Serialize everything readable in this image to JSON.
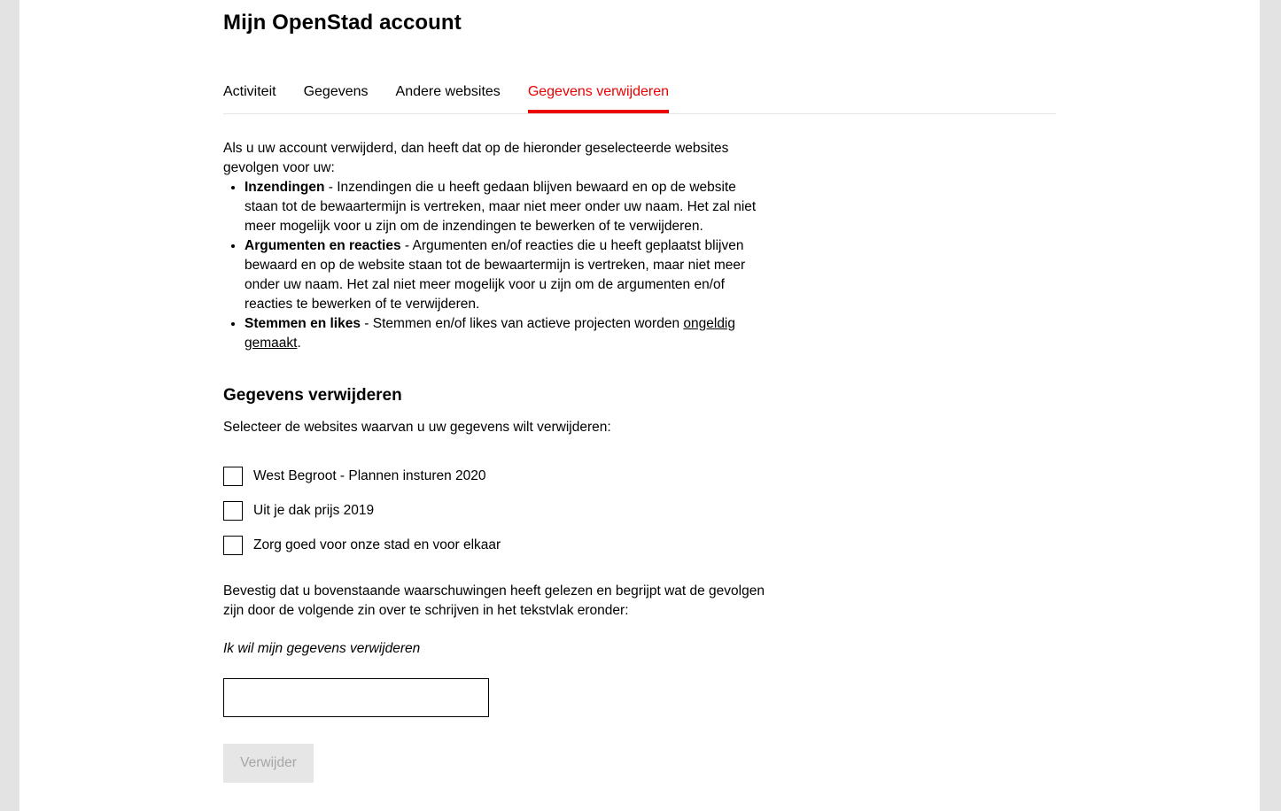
{
  "header": {
    "title": "Mijn OpenStad account"
  },
  "tabs": [
    {
      "label": "Activiteit"
    },
    {
      "label": "Gegevens"
    },
    {
      "label": "Andere websites"
    },
    {
      "label": "Gegevens verwijderen",
      "active": true
    }
  ],
  "intro": {
    "text": "Als u uw account verwijderd, dan heeft dat op de hieronder geselecteerde websites gevolgen voor uw:",
    "items": [
      {
        "title": "Inzendingen",
        "text": " - Inzendingen die u heeft gedaan blijven bewaard en op de website staan tot de bewaartermijn is vertreken, maar niet meer onder uw naam. Het zal niet meer mogelijk voor u zijn om de inzendingen te bewerken of te verwijderen."
      },
      {
        "title": "Argumenten en reacties",
        "text": " - Argumenten en/of reacties die u heeft geplaatst blijven bewaard en op de website staan tot de bewaartermijn is vertreken, maar niet meer onder uw naam. Het zal niet meer mogelijk voor u zijn om de argumenten en/of reacties te bewerken of te verwijderen."
      },
      {
        "title": "Stemmen en likes",
        "text": " - Stemmen en/of likes van actieve projecten worden ",
        "link": "ongeldig gemaakt",
        "after": "."
      }
    ]
  },
  "section": {
    "title": "Gegevens verwijderen",
    "select_text": "Selecteer de websites waarvan u uw gegevens wilt verwijderen:",
    "sites": [
      {
        "label": "West Begroot - Plannen insturen 2020",
        "checked": false
      },
      {
        "label": "Uit je dak prijs 2019",
        "checked": false
      },
      {
        "label": "Zorg goed voor onze stad en voor elkaar",
        "checked": false
      }
    ],
    "confirm_text": "Bevestig dat u bovenstaande waarschuwingen heeft gelezen en begrijpt wat de gevolgen zijn door de volgende zin over te schrijven in het tekstvlak eronder:",
    "confirm_phrase": "Ik wil mijn gegevens verwijderen",
    "input_value": "",
    "button_label": "Verwijder"
  },
  "colors": {
    "accent": "#ec0000",
    "button_disabled_bg": "#e6e6e6",
    "button_disabled_text": "#a6a6a6",
    "page_bg": "#e3e3e3"
  }
}
